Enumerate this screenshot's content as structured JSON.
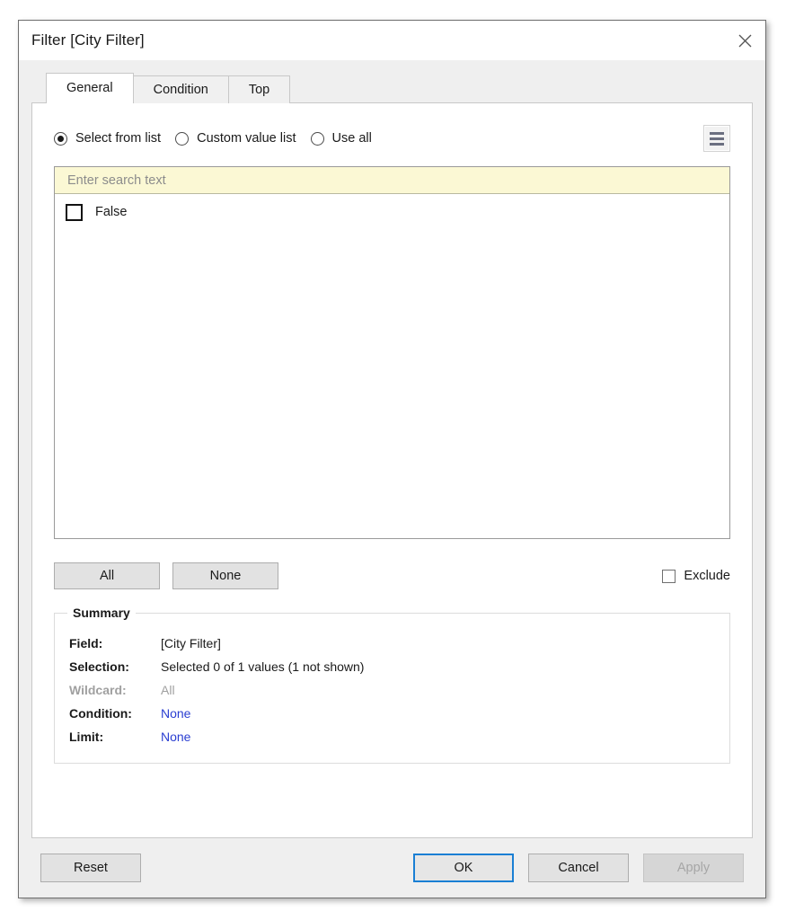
{
  "window": {
    "title": "Filter [City Filter]",
    "close_icon": "close-icon"
  },
  "tabs": [
    {
      "label": "General",
      "active": true
    },
    {
      "label": "Condition",
      "active": false
    },
    {
      "label": "Top",
      "active": false
    }
  ],
  "general": {
    "modes": [
      {
        "label": "Select from list",
        "selected": true
      },
      {
        "label": "Custom value list",
        "selected": false
      },
      {
        "label": "Use all",
        "selected": false
      }
    ],
    "menu_button": {
      "icon": "hamburger-menu-icon"
    },
    "search": {
      "placeholder": "Enter search text",
      "value": ""
    },
    "values": [
      {
        "label": "False",
        "checked": false
      }
    ],
    "all_button": "All",
    "none_button": "None",
    "exclude": {
      "label": "Exclude",
      "checked": false
    }
  },
  "summary": {
    "legend": "Summary",
    "rows": [
      {
        "key": "Field:",
        "value": "[City Filter]",
        "style": "normal"
      },
      {
        "key": "Selection:",
        "value": "Selected 0 of 1 values (1 not shown)",
        "style": "normal"
      },
      {
        "key": "Wildcard:",
        "value": "All",
        "style": "dim"
      },
      {
        "key": "Condition:",
        "value": "None",
        "style": "link"
      },
      {
        "key": "Limit:",
        "value": "None",
        "style": "link"
      }
    ]
  },
  "footer": {
    "reset": "Reset",
    "ok": "OK",
    "cancel": "Cancel",
    "apply": "Apply"
  },
  "colors": {
    "accent": "#1a7fd4",
    "link": "#2a3ed1",
    "search_bg": "#fbf8d4",
    "dialog_bg": "#efefef"
  }
}
